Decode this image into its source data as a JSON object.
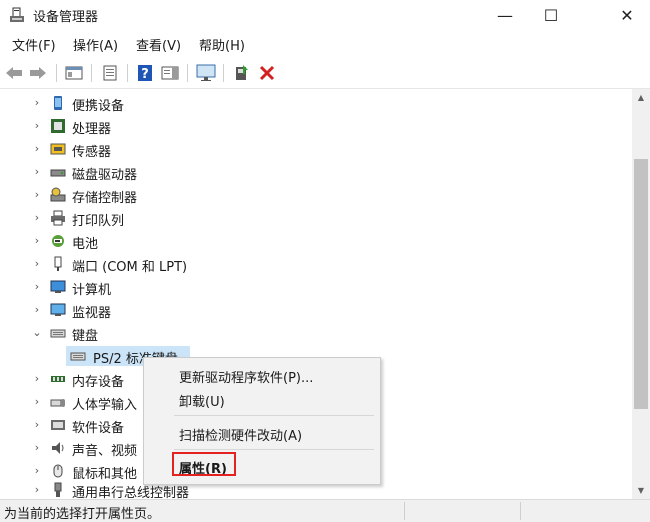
{
  "window": {
    "title": "设备管理器",
    "minimize_glyph": "—",
    "maximize_glyph": "☐",
    "close_glyph": "✕"
  },
  "menu": {
    "items": [
      {
        "label": "文件(F)"
      },
      {
        "label": "操作(A)"
      },
      {
        "label": "查看(V)"
      },
      {
        "label": "帮助(H)"
      }
    ]
  },
  "toolbar": {
    "buttons": [
      "back-arrow-icon",
      "forward-arrow-icon",
      "show-hide-tree-icon",
      "properties-sheet-icon",
      "help-icon",
      "action-pane-icon",
      "monitor-icon",
      "update-driver-icon",
      "uninstall-x-icon"
    ]
  },
  "tree": {
    "items": [
      {
        "label": "便携设备",
        "icon": "portable-device-icon",
        "expanded": false
      },
      {
        "label": "处理器",
        "icon": "processor-icon",
        "expanded": false
      },
      {
        "label": "传感器",
        "icon": "sensor-icon",
        "expanded": false
      },
      {
        "label": "磁盘驱动器",
        "icon": "disk-drive-icon",
        "expanded": false
      },
      {
        "label": "存储控制器",
        "icon": "storage-controller-icon",
        "expanded": false
      },
      {
        "label": "打印队列",
        "icon": "printer-icon",
        "expanded": false
      },
      {
        "label": "电池",
        "icon": "battery-icon",
        "expanded": false
      },
      {
        "label": "端口 (COM 和 LPT)",
        "icon": "port-icon",
        "expanded": false
      },
      {
        "label": "计算机",
        "icon": "computer-icon",
        "expanded": false
      },
      {
        "label": "监视器",
        "icon": "monitor-icon",
        "expanded": false
      },
      {
        "label": "键盘",
        "icon": "keyboard-icon",
        "expanded": true
      },
      {
        "label": "PS/2 标准键盘",
        "icon": "keyboard-icon",
        "child": true,
        "selected": true
      },
      {
        "label": "内存设备",
        "icon": "memory-icon",
        "expanded": false
      },
      {
        "label": "人体学输入",
        "icon": "hid-icon",
        "expanded": false
      },
      {
        "label": "软件设备",
        "icon": "software-device-icon",
        "expanded": false
      },
      {
        "label": "声音、视频",
        "icon": "speaker-icon",
        "expanded": false
      },
      {
        "label": "鼠标和其他",
        "icon": "mouse-icon",
        "expanded": false
      },
      {
        "label": "通用串行总线控制器",
        "icon": "usb-icon",
        "expanded": false
      }
    ],
    "collapsed_glyph": "›",
    "expanded_glyph": "⌄"
  },
  "context_menu": {
    "items": [
      {
        "label": "更新驱动程序软件(P)..."
      },
      {
        "label": "卸载(U)"
      },
      {
        "label": "扫描检测硬件改动(A)"
      },
      {
        "label": "属性(R)",
        "bold": true,
        "highlighted": true
      }
    ]
  },
  "statusbar": {
    "text": "为当前的选择打开属性页。"
  },
  "colors": {
    "selection": "#cce4f7",
    "highlight_box": "#e52222",
    "menu_bg": "#f2f2f2",
    "close_x_red": "#d32020"
  }
}
